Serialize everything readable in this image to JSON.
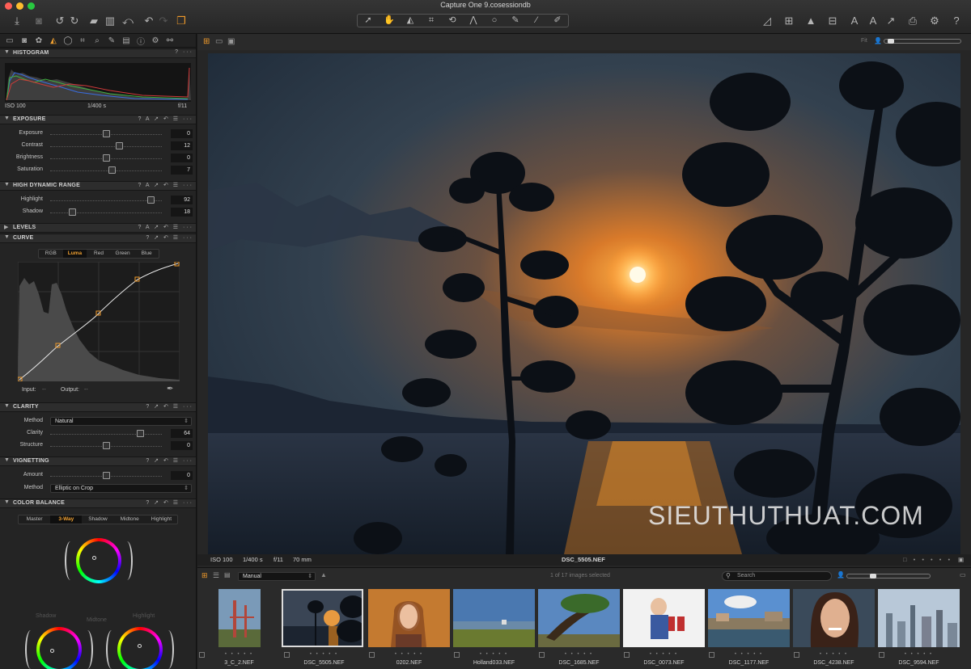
{
  "window": {
    "title": "Capture One 9.cosessiondb"
  },
  "toolbar": {
    "fit_label": "Fit"
  },
  "histogram": {
    "title": "HISTOGRAM",
    "iso": "ISO 100",
    "shutter": "1/400 s",
    "aperture": "f/11"
  },
  "exposure": {
    "title": "EXPOSURE",
    "rows": [
      {
        "label": "Exposure",
        "value": "0",
        "level": 0.5
      },
      {
        "label": "Contrast",
        "value": "12",
        "level": 0.62
      },
      {
        "label": "Brightness",
        "value": "0",
        "level": 0.5
      },
      {
        "label": "Saturation",
        "value": "7",
        "level": 0.55
      }
    ]
  },
  "hdr": {
    "title": "HIGH DYNAMIC RANGE",
    "rows": [
      {
        "label": "Highlight",
        "value": "92",
        "level": 0.92
      },
      {
        "label": "Shadow",
        "value": "18",
        "level": 0.18
      }
    ]
  },
  "levels": {
    "title": "LEVELS"
  },
  "curve": {
    "title": "CURVE",
    "tabs": [
      "RGB",
      "Luma",
      "Red",
      "Green",
      "Blue"
    ],
    "active_tab": "Luma",
    "input_label": "Input:",
    "input_value": "--",
    "output_label": "Output:",
    "output_value": "--"
  },
  "clarity": {
    "title": "CLARITY",
    "method_label": "Method",
    "method_value": "Natural",
    "rows": [
      {
        "label": "Clarity",
        "value": "64",
        "level": 0.82
      },
      {
        "label": "Structure",
        "value": "0",
        "level": 0.5
      }
    ]
  },
  "vignetting": {
    "title": "VIGNETTING",
    "amount_label": "Amount",
    "amount_value": "0",
    "amount_level": 0.5,
    "method_label": "Method",
    "method_value": "Elliptic on Crop"
  },
  "color_balance": {
    "title": "COLOR BALANCE",
    "tabs": [
      "Master",
      "3-Way",
      "Shadow",
      "Midtone",
      "Highlight"
    ],
    "active_tab": "3-Way",
    "wheel_labels": {
      "midtone": "Midtone",
      "shadow": "Shadow",
      "highlight": "Highlight"
    }
  },
  "viewer": {
    "iso": "ISO 100",
    "shutter": "1/400 s",
    "aperture": "f/11",
    "focal": "70 mm",
    "filename": "DSC_5505.NEF",
    "watermark": "SIEUTHUTHUAT.COM"
  },
  "browser": {
    "sort_value": "Manual",
    "count_text": "1 of 17 images selected",
    "search_placeholder": "Search",
    "files": [
      "3_C_2.NEF",
      "DSC_5505.NEF",
      "0202.NEF",
      "Holland033.NEF",
      "DSC_1685.NEF",
      "DSC_0073.NEF",
      "DSC_1177.NEF",
      "DSC_4238.NEF",
      "DSC_9594.NEF"
    ]
  }
}
